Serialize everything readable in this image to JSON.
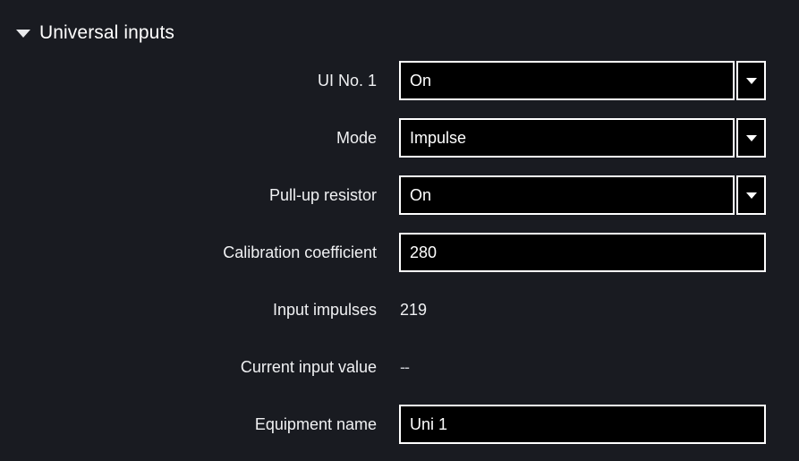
{
  "section": {
    "title": "Universal inputs",
    "collapse_icon": "caret-down-icon",
    "expanded": true
  },
  "colors": {
    "background": "#191b21",
    "field_background": "#000000",
    "field_border": "#ffffff",
    "text": "#f0f1f3"
  },
  "form": {
    "rows": [
      {
        "label": "UI No. 1",
        "type": "select",
        "value": "On",
        "icon": "chevron-down-icon",
        "name": "ui-no-1"
      },
      {
        "label": "Mode",
        "type": "select",
        "value": "Impulse",
        "icon": "chevron-down-icon",
        "name": "mode"
      },
      {
        "label": "Pull-up resistor",
        "type": "select",
        "value": "On",
        "icon": "chevron-down-icon",
        "name": "pull-up-resistor"
      },
      {
        "label": "Calibration coefficient",
        "type": "text",
        "value": "280",
        "name": "calibration-coefficient"
      },
      {
        "label": "Input impulses",
        "type": "readonly",
        "value": "219",
        "name": "input-impulses"
      },
      {
        "label": "Current input value",
        "type": "readonly",
        "value": "--",
        "name": "current-input-value"
      },
      {
        "label": "Equipment name",
        "type": "text",
        "value": "Uni 1",
        "name": "equipment-name"
      }
    ]
  }
}
